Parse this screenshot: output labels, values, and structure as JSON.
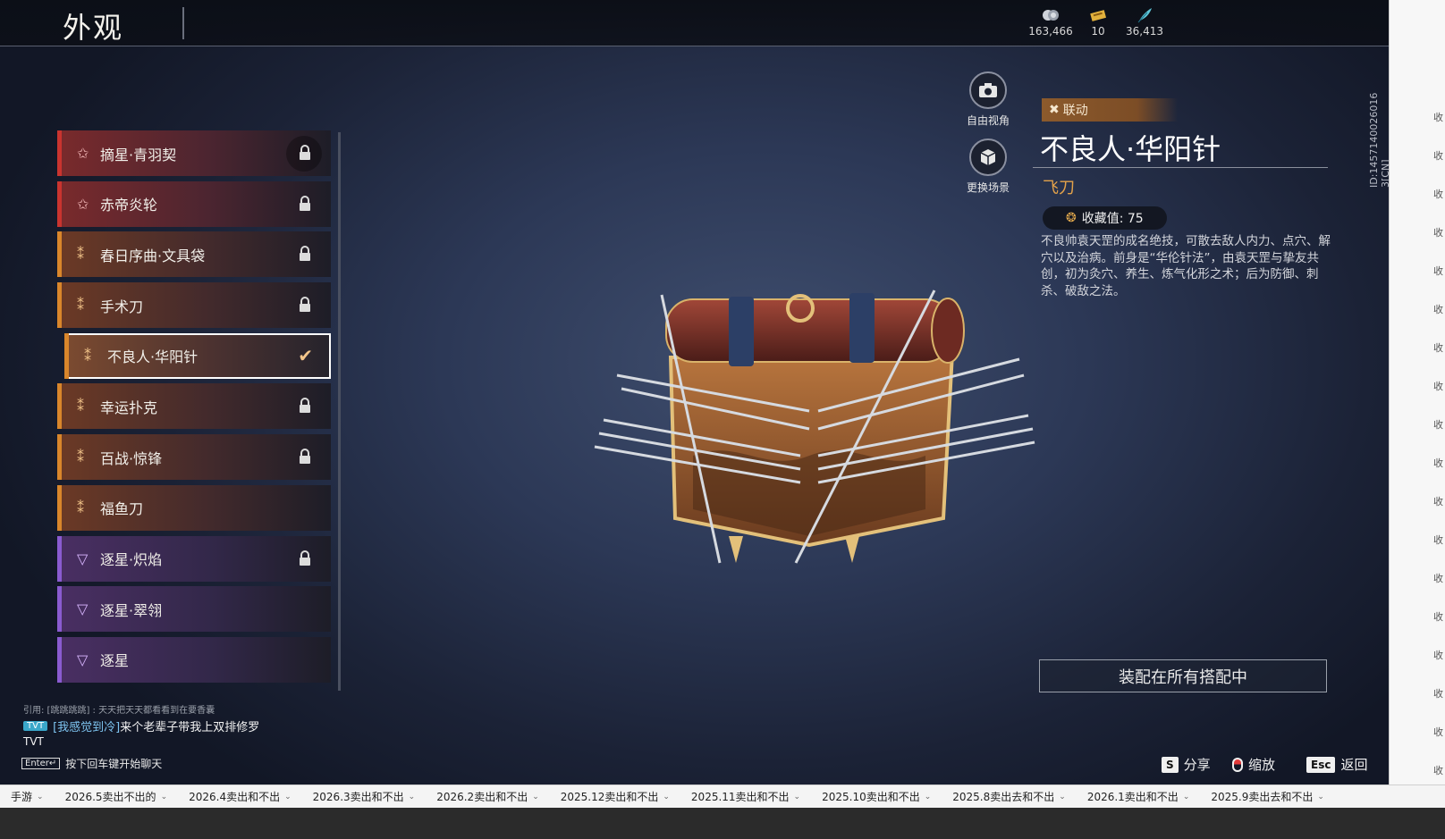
{
  "header": {
    "title": "外观",
    "currencies": [
      {
        "icon": "silver-coin-icon",
        "value": "163,466"
      },
      {
        "icon": "ticket-icon",
        "value": "10"
      },
      {
        "icon": "feather-icon",
        "value": "36,413"
      }
    ]
  },
  "list": {
    "items": [
      {
        "name": "摘星·青羽契",
        "tier": "red",
        "icon": "star-icon",
        "state": "locked"
      },
      {
        "name": "赤帝炎轮",
        "tier": "red",
        "icon": "star-icon",
        "state": "locked"
      },
      {
        "name": "春日序曲·文具袋",
        "tier": "gold",
        "icon": "cross-blades-icon",
        "state": "locked"
      },
      {
        "name": "手术刀",
        "tier": "gold",
        "icon": "cross-blades-icon",
        "state": "locked"
      },
      {
        "name": "不良人·华阳针",
        "tier": "gold",
        "icon": "cross-blades-icon",
        "state": "equipped"
      },
      {
        "name": "幸运扑克",
        "tier": "gold",
        "icon": "cross-blades-icon",
        "state": "locked"
      },
      {
        "name": "百战·惊锋",
        "tier": "gold",
        "icon": "cross-blades-icon",
        "state": "locked"
      },
      {
        "name": "福鱼刀",
        "tier": "gold",
        "icon": "cross-blades-icon",
        "state": "owned"
      },
      {
        "name": "逐星·炽焰",
        "tier": "purple",
        "icon": "chevron-wings-icon",
        "state": "locked"
      },
      {
        "name": "逐星·翠翎",
        "tier": "purple",
        "icon": "chevron-wings-icon",
        "state": "owned"
      },
      {
        "name": "逐星",
        "tier": "purple",
        "icon": "chevron-wings-icon",
        "state": "owned"
      }
    ]
  },
  "camera": {
    "free_view_label": "自由视角",
    "change_scene_label": "更换场景"
  },
  "detail": {
    "tag": "联动",
    "title": "不良人·华阳针",
    "type": "飞刀",
    "collect_label": "收藏值: 75",
    "description": "不良帅袁天罡的成名绝技，可散去敌人内力、点穴、解穴以及治病。前身是“华伦针法”，由袁天罡与挚友共创，初为灸穴、养生、炼气化形之术；后为防御、刺杀、破敌之法。",
    "equip_button": "装配在所有搭配中",
    "id_text": "ID:1457140026016 3[CN]"
  },
  "hints": {
    "share_key": "S",
    "share_label": "分享",
    "zoom_label": "缩放",
    "back_key": "Esc",
    "back_label": "返回"
  },
  "chat": {
    "quote": "引用: [跳跳跳跳] : 天天把天天都看看到在要香囊",
    "badge": "TVT",
    "user": "[我感觉到冷]",
    "message": "来个老辈子带我上双排修罗",
    "line2": "TVT",
    "enter_key": "Enter↵",
    "enter_hint": "按下回车键开始聊天"
  },
  "taskbar": {
    "items": [
      "手游",
      "2026.5卖出不出的",
      "2026.4卖出和不出",
      "2026.3卖出和不出",
      "2026.2卖出和不出",
      "2025.12卖出和不出",
      "2025.11卖出和不出",
      "2025.10卖出和不出",
      "2025.8卖出去和不出",
      "2026.1卖出和不出",
      "2025.9卖出去和不出"
    ]
  },
  "edge_column": [
    "收",
    "收",
    "收",
    "收",
    "收",
    "收",
    "收",
    "收",
    "收",
    "收",
    "收",
    "收",
    "收",
    "收",
    "收",
    "收",
    "收",
    "收"
  ],
  "colors": {
    "red": "#c9342f",
    "gold": "#d9862b",
    "purple": "#8a5bd0",
    "accent_text": "#e3a24a"
  }
}
